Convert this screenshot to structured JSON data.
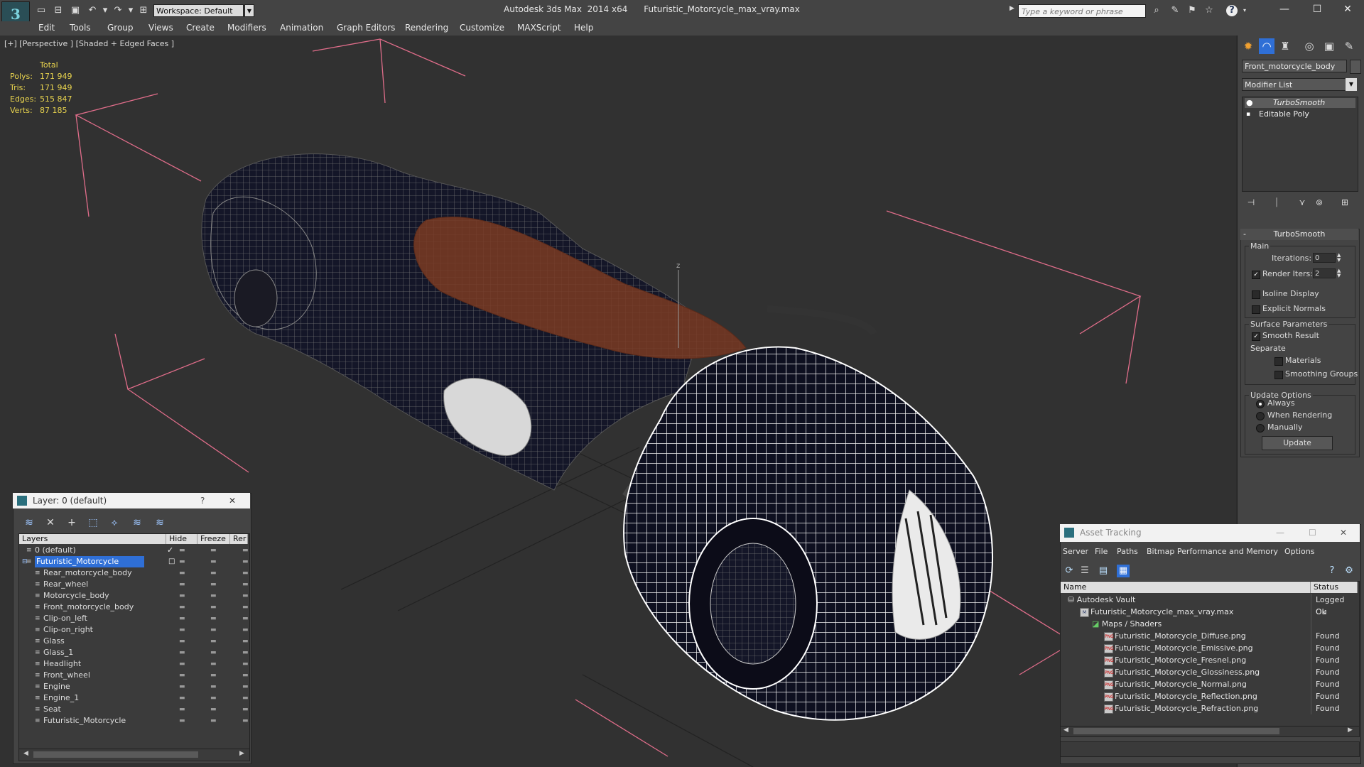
{
  "app": {
    "title": "Autodesk 3ds Max  2014 x64",
    "filename": "Futuristic_Motorcycle_max_vray.max",
    "logo_text": "3",
    "workspace": "Workspace: Default",
    "search_placeholder": "Type a keyword or phrase"
  },
  "menu": [
    "Edit",
    "Tools",
    "Group",
    "Views",
    "Create",
    "Modifiers",
    "Animation",
    "Graph Editors",
    "Rendering",
    "Customize",
    "MAXScript",
    "Help"
  ],
  "viewport": {
    "label": "[+] [Perspective ] [Shaded + Edged Faces ]",
    "stats_header": "Total",
    "stats": [
      {
        "label": "Polys:",
        "value": "171 949"
      },
      {
        "label": "Tris:",
        "value": "171 949"
      },
      {
        "label": "Edges:",
        "value": "515 847"
      },
      {
        "label": "Verts:",
        "value": "87 185"
      }
    ],
    "axis_label": "z"
  },
  "command_panel": {
    "object_name": "Front_motorcycle_body",
    "modifier_list": "Modifier List",
    "stack": [
      "TurboSmooth",
      "Editable Poly"
    ],
    "rollout_title": "TurboSmooth",
    "main_group": "Main",
    "iterations_label": "Iterations:",
    "iterations_value": "0",
    "render_iters_label": "Render Iters:",
    "render_iters_value": "2",
    "isoline_label": "Isoline Display",
    "explicit_normals_label": "Explicit Normals",
    "surface_group": "Surface Parameters",
    "smooth_result_label": "Smooth Result",
    "separate_label": "Separate",
    "materials_label": "Materials",
    "smoothing_groups_label": "Smoothing Groups",
    "update_group": "Update Options",
    "update_options": [
      "Always",
      "When Rendering",
      "Manually"
    ],
    "update_button": "Update"
  },
  "layer_dialog": {
    "title": "Layer: 0 (default)",
    "help": "?",
    "close": "✕",
    "columns": [
      "Layers",
      "Hide",
      "Freeze",
      "Rer"
    ],
    "rows": [
      {
        "name": "0 (default)",
        "level": 0,
        "selected": false
      },
      {
        "name": "Futuristic_Motorcycle",
        "level": 0,
        "selected": true
      },
      {
        "name": "Rear_motorcycle_body",
        "level": 1,
        "selected": false
      },
      {
        "name": "Rear_wheel",
        "level": 1,
        "selected": false
      },
      {
        "name": "Motorcycle_body",
        "level": 1,
        "selected": false
      },
      {
        "name": "Front_motorcycle_body",
        "level": 1,
        "selected": false
      },
      {
        "name": "Clip-on_left",
        "level": 1,
        "selected": false
      },
      {
        "name": "Clip-on_right",
        "level": 1,
        "selected": false
      },
      {
        "name": "Glass",
        "level": 1,
        "selected": false
      },
      {
        "name": "Glass_1",
        "level": 1,
        "selected": false
      },
      {
        "name": "Headlight",
        "level": 1,
        "selected": false
      },
      {
        "name": "Front_wheel",
        "level": 1,
        "selected": false
      },
      {
        "name": "Engine",
        "level": 1,
        "selected": false
      },
      {
        "name": "Engine_1",
        "level": 1,
        "selected": false
      },
      {
        "name": "Seat",
        "level": 1,
        "selected": false
      },
      {
        "name": "Futuristic_Motorcycle",
        "level": 1,
        "selected": false
      }
    ]
  },
  "asset_dialog": {
    "title": "Asset Tracking",
    "menu": [
      "Server",
      "File",
      "Paths",
      "Bitmap Performance and Memory",
      "Options"
    ],
    "columns": [
      "Name",
      "Status"
    ],
    "rows": [
      {
        "name": "Autodesk Vault",
        "status": "Logged Ou",
        "level": 0,
        "kind": "vault"
      },
      {
        "name": "Futuristic_Motorcycle_max_vray.max",
        "status": "Ok",
        "level": 1,
        "kind": "max"
      },
      {
        "name": "Maps / Shaders",
        "status": "",
        "level": 2,
        "kind": "folder"
      },
      {
        "name": "Futuristic_Motorcycle_Diffuse.png",
        "status": "Found",
        "level": 3,
        "kind": "png"
      },
      {
        "name": "Futuristic_Motorcycle_Emissive.png",
        "status": "Found",
        "level": 3,
        "kind": "png"
      },
      {
        "name": "Futuristic_Motorcycle_Fresnel.png",
        "status": "Found",
        "level": 3,
        "kind": "png"
      },
      {
        "name": "Futuristic_Motorcycle_Glossiness.png",
        "status": "Found",
        "level": 3,
        "kind": "png"
      },
      {
        "name": "Futuristic_Motorcycle_Normal.png",
        "status": "Found",
        "level": 3,
        "kind": "png"
      },
      {
        "name": "Futuristic_Motorcycle_Reflection.png",
        "status": "Found",
        "level": 3,
        "kind": "png"
      },
      {
        "name": "Futuristic_Motorcycle_Refraction.png",
        "status": "Found",
        "level": 3,
        "kind": "png"
      }
    ]
  },
  "colors": {
    "stats_yellow": "#e9d44e",
    "selection_blue": "#2f6fd6",
    "gizmo_pink": "#e06d8a",
    "seat_brown": "#6b3523"
  }
}
